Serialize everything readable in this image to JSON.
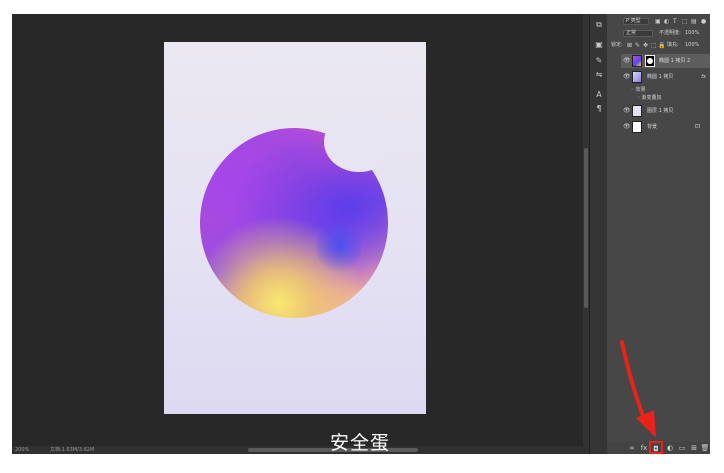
{
  "status": {
    "zoom": "200%",
    "doc_info": "文档:1.63M/3.82M"
  },
  "watermark": "安全蛋",
  "panel_toolbar": {
    "filter_kind": "P 类型",
    "blend_mode": "正常",
    "opacity_label": "不透明度:",
    "opacity_value": "100%",
    "lock_label": "锁定:",
    "fill_label": "填充:",
    "fill_value": "100%"
  },
  "layers": [
    {
      "name": "椭圆 1 拷贝 2",
      "selected": true,
      "has_mask": true,
      "fx": ""
    },
    {
      "name": "椭圆 1 拷贝",
      "selected": false,
      "has_mask": false,
      "fx": "fx"
    },
    {
      "name": "图层 1 拷贝",
      "selected": false,
      "has_mask": false,
      "fx": ""
    },
    {
      "name": "背景",
      "selected": false,
      "has_mask": false,
      "fx": "",
      "locked": true
    }
  ],
  "layer_effects": {
    "effects_label": "效果",
    "gradient_overlay": "渐变叠加"
  },
  "colors": {
    "highlight": "#e8231b",
    "workspace": "#282828",
    "panel": "#474747"
  }
}
